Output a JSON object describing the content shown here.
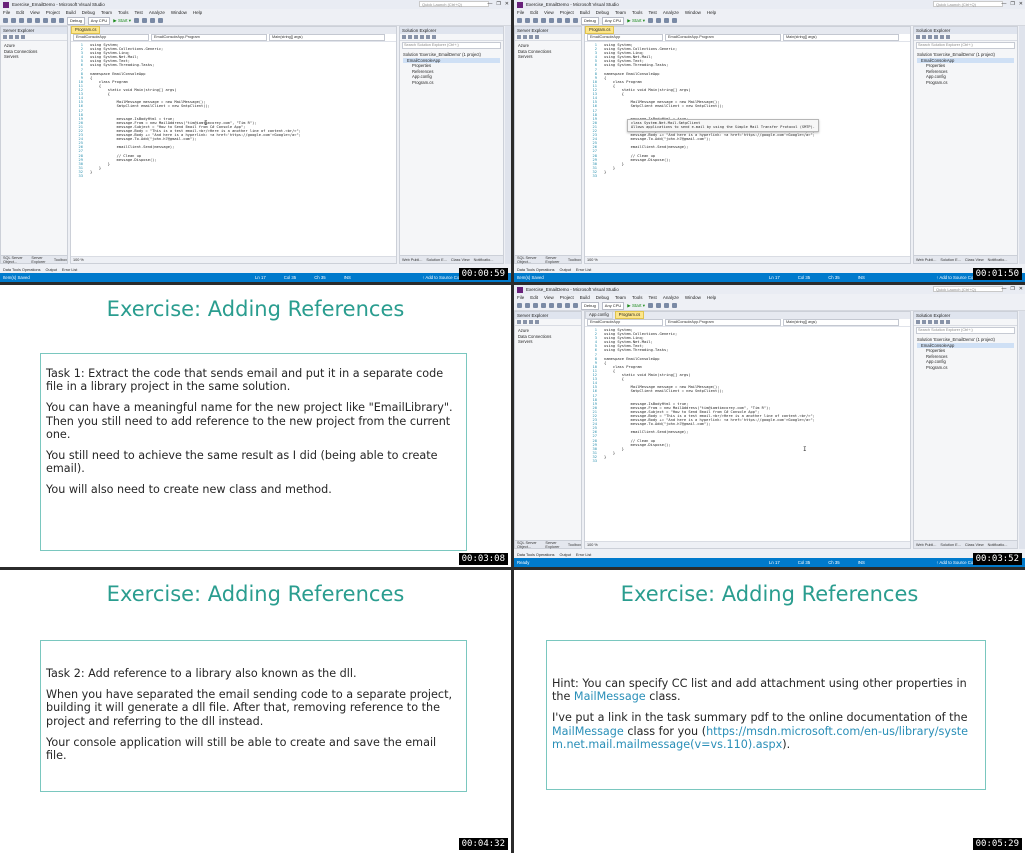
{
  "timestamps": [
    "00:00:59",
    "00:01:50",
    "00:03:08",
    "00:03:52",
    "00:04:32",
    "00:05:29"
  ],
  "vs": {
    "title": "Exercise_EmailDemo - Microsoft Visual Studio",
    "quick_launch": "Quick Launch (Ctrl+Q)",
    "window_controls": [
      "—",
      "❐",
      "✕"
    ],
    "menu": [
      "File",
      "Edit",
      "View",
      "Project",
      "Build",
      "Debug",
      "Team",
      "Tools",
      "Test",
      "Analyze",
      "Window",
      "Help"
    ],
    "toolbar": {
      "config": "Debug",
      "platform": "Any CPU",
      "start": "▶ Start ▾"
    },
    "server_explorer": {
      "title": "Server Explorer",
      "items": [
        "Azure",
        "Data Connections",
        "Servers"
      ],
      "bottom_tabs": [
        "SQL Server Object...",
        "Server Explorer",
        "Toolbox"
      ]
    },
    "editor": {
      "tab_program": "Program.cs",
      "tab_app_config": "App.config",
      "nav_project": "EmailConsoleApp",
      "nav_class": "EmailConsoleApp.Program",
      "nav_member": "Main(string[] args)",
      "zoom": "100 %"
    },
    "solution_explorer": {
      "title": "Solution Explorer",
      "search": "Search Solution Explorer (Ctrl+;)",
      "items": [
        "Solution 'Exercise_EmailDemo' (1 project)",
        "EmailConsoleApp",
        "Properties",
        "References",
        "App.config",
        "Program.cs"
      ],
      "bottom_tabs": [
        "Web Publi...",
        "Solution E...",
        "Class View",
        "Notificatio..."
      ]
    },
    "bottom_tabs": [
      "Data Tools Operations",
      "Output",
      "Error List"
    ],
    "status": {
      "item_saved": "Item(s) Saved",
      "ready": "Ready",
      "ln": "Ln 17",
      "col": "Col 35",
      "ch": "Ch 35",
      "ins": "INS",
      "source_control": "↑ Add to Source Control ▴"
    },
    "tooltip": {
      "line1": "class System.Net.Mail.SmtpClient",
      "line2": "Allows applications to send e-mail by using the Simple Mail Transfer Protocol (SMTP)."
    }
  },
  "code": [
    {
      "n": "1",
      "t": "using System;"
    },
    {
      "n": "2",
      "t": "using System.Collections.Generic;"
    },
    {
      "n": "3",
      "t": "using System.Linq;"
    },
    {
      "n": "4",
      "t": "using System.Net.Mail;"
    },
    {
      "n": "5",
      "t": "using System.Text;"
    },
    {
      "n": "6",
      "t": "using System.Threading.Tasks;"
    },
    {
      "n": "7",
      "t": ""
    },
    {
      "n": "8",
      "t": "namespace EmailConsoleApp"
    },
    {
      "n": "9",
      "t": "{"
    },
    {
      "n": "10",
      "t": "    class Program"
    },
    {
      "n": "11",
      "t": "    {"
    },
    {
      "n": "12",
      "t": "        static void Main(string[] args)"
    },
    {
      "n": "13",
      "t": "        {"
    },
    {
      "n": "14",
      "t": ""
    },
    {
      "n": "15",
      "t": "            MailMessage message = new MailMessage();"
    },
    {
      "n": "16",
      "t": "            SmtpClient emailClient = new SmtpClient();"
    },
    {
      "n": "17",
      "t": ""
    },
    {
      "n": "18",
      "t": ""
    },
    {
      "n": "19",
      "t": "            message.IsBodyHtml = true;"
    },
    {
      "n": "20",
      "t": "            message.From = new MailAddress(\"tim@iamtimcorey.com\", \"Tim R\");"
    },
    {
      "n": "21",
      "t": "            message.Subject = \"How to Send Email from C# Console App\";"
    },
    {
      "n": "22",
      "t": "            message.Body = \"This is a test email.<br/>Here is a another line of content.<br/>\";"
    },
    {
      "n": "23",
      "t": "            message.Body += \"And here is a hyperlink: <a href='https://google.com'>Google</a>\";"
    },
    {
      "n": "24",
      "t": "            message.To.Add(\"john.h7@gmail.com\");"
    },
    {
      "n": "25",
      "t": ""
    },
    {
      "n": "26",
      "t": "            emailClient.Send(message);"
    },
    {
      "n": "27",
      "t": ""
    },
    {
      "n": "28",
      "t": "            // Clean up"
    },
    {
      "n": "29",
      "t": "            message.Dispose();"
    },
    {
      "n": "30",
      "t": "        }"
    },
    {
      "n": "31",
      "t": "    }"
    },
    {
      "n": "32",
      "t": "}"
    },
    {
      "n": "33",
      "t": ""
    }
  ],
  "colors": {
    "slide_title": "#2a9d8f",
    "box_border": "#7ac7bf",
    "link": "#2a8fb8",
    "vs_status": "#007acc"
  },
  "slides": {
    "task1": {
      "title": "Exercise: Adding References",
      "p1": "Task 1: Extract the code that sends email and put it in a separate code file in a library project in the same solution.",
      "p2": "You can have a meaningful name for the new project like \"EmailLibrary\". Then you still need to add reference to the new project from the current one.",
      "p3": "You still need to achieve the same result as I did (being able to create email).",
      "p4": "You will also need to create new class and method."
    },
    "task2": {
      "title": "Exercise: Adding References",
      "p1": "Task 2: Add reference to a library also known as the dll.",
      "p2": "When you have separated the email sending code to a separate project, building it will generate a dll file. After that, removing reference to the project and referring to the dll instead.",
      "p3": "Your console application will still be able to create and save the email file."
    },
    "hint": {
      "title": "Exercise: Adding References",
      "h1a": "Hint: You can specify CC list and add attachment using other properties in the ",
      "h1b": "MailMessage",
      "h1c": " class.",
      "h2a": "I've put a link in the task summary pdf to the online documentation of the ",
      "h2b": "MailMessage",
      "h2c": " class for you (",
      "h2d": "https://msdn.microsoft.com/en-us/library/system.net.mail.mailmessage(v=vs.110).aspx",
      "h2e": ")."
    }
  }
}
